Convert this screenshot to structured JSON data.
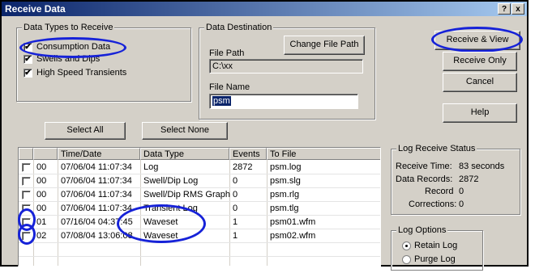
{
  "window": {
    "title": "Receive Data",
    "help_btn": "?",
    "close_btn": "x"
  },
  "data_types": {
    "label": "Data Types to Receive",
    "items": [
      {
        "label": "Consumption Data",
        "checked": true
      },
      {
        "label": "Swells and Dips",
        "checked": true
      },
      {
        "label": "High Speed Transients",
        "checked": true
      }
    ]
  },
  "destination": {
    "label": "Data Destination",
    "change_path_button": "Change File Path",
    "file_path_label": "File Path",
    "file_path_value": "C:\\xx",
    "file_name_label": "File Name",
    "file_name_value": "psm"
  },
  "buttons": {
    "receive_view": "Receive & View",
    "receive_only": "Receive Only",
    "cancel": "Cancel",
    "help": "Help",
    "select_all": "Select All",
    "select_none": "Select None"
  },
  "table": {
    "columns": [
      "Time/Date",
      "Data Type",
      "Events",
      "To File"
    ],
    "rows": [
      {
        "checked": false,
        "id": "00",
        "time": "07/06/04 11:07:34",
        "type": "Log",
        "events": "2872",
        "file": "psm.log"
      },
      {
        "checked": false,
        "id": "00",
        "time": "07/06/04 11:07:34",
        "type": "Swell/Dip Log",
        "events": "0",
        "file": "psm.slg"
      },
      {
        "checked": false,
        "id": "00",
        "time": "07/06/04 11:07:34",
        "type": "Swell/Dip RMS Graph",
        "events": "0",
        "file": "psm.rlg"
      },
      {
        "checked": false,
        "id": "00",
        "time": "07/06/04 11:07:34",
        "type": "Transient Log",
        "events": "0",
        "file": "psm.tlg"
      },
      {
        "checked": false,
        "id": "01",
        "time": "07/16/04 04:37:45",
        "type": "Waveset",
        "events": "1",
        "file": "psm01.wfm"
      },
      {
        "checked": false,
        "id": "02",
        "time": "07/08/04 13:06:08",
        "type": "Waveset",
        "events": "1",
        "file": "psm02.wfm"
      }
    ]
  },
  "status": {
    "label": "Log Receive Status",
    "receive_time_label": "Receive Time:",
    "receive_time_value": "83 seconds",
    "data_records_label": "Data Records:",
    "data_records_value": "2872",
    "record_label": "Record",
    "record_value": "0",
    "corrections_label": "Corrections:",
    "corrections_value": "0"
  },
  "log_options": {
    "label": "Log Options",
    "retain": "Retain Log",
    "purge": "Purge Log",
    "selected": "retain"
  },
  "colors": {
    "annotation": "#1622d8",
    "title_bar": "#0a246a"
  }
}
